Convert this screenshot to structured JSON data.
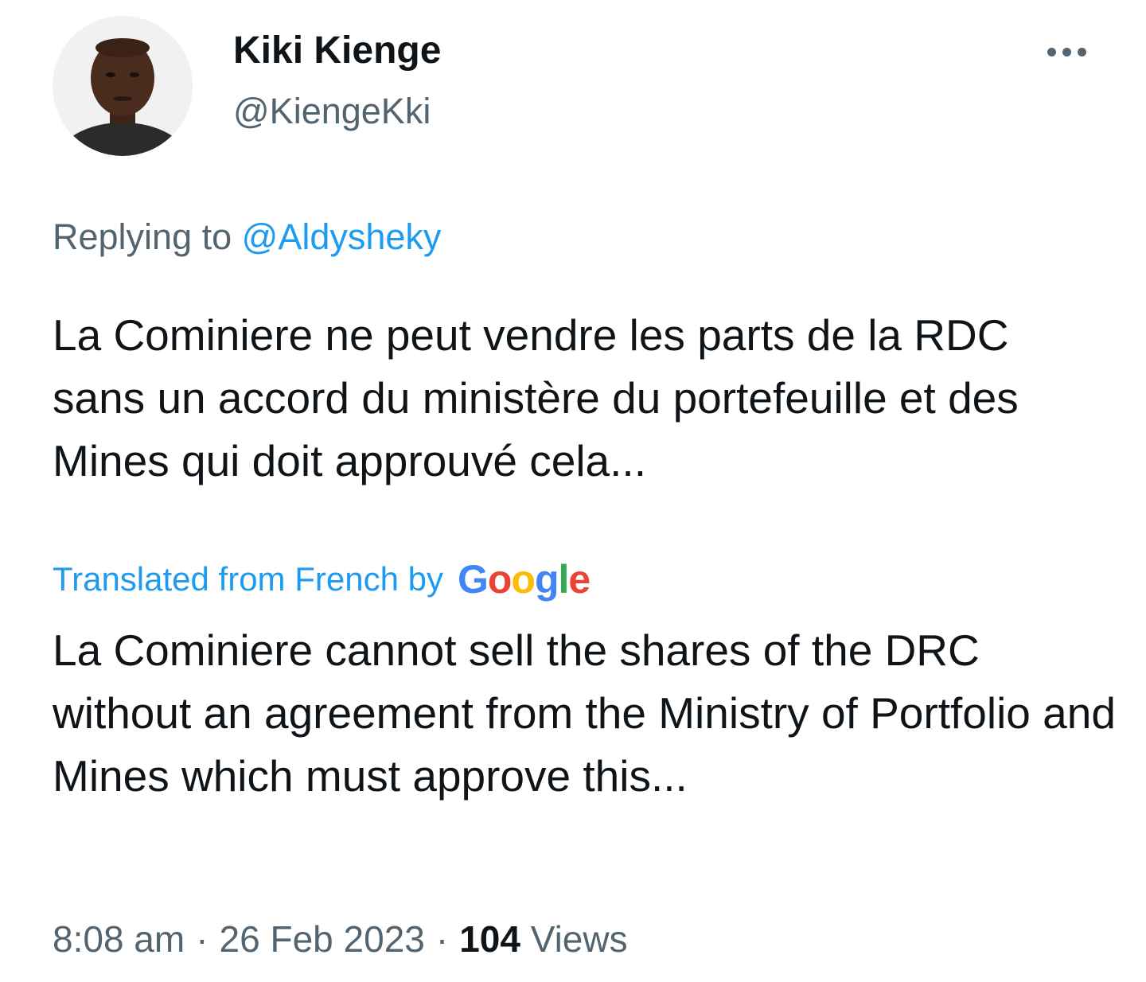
{
  "tweet": {
    "author": {
      "display_name": "Kiki Kienge",
      "handle": "@KiengeKki"
    },
    "more_icon": "more-horizontal-icon",
    "replying_to": {
      "prefix": "Replying to",
      "mention": "@Aldysheky"
    },
    "text": "La Cominiere ne peut vendre les parts de la RDC sans un accord du ministère du portefeuille et des Mines qui doit approuvé cela...",
    "translation": {
      "label": "Translated from French by",
      "provider": "Google",
      "text": "La Cominiere cannot sell the shares of the DRC without an agreement from the Ministry of Portfolio and Mines which must approve this..."
    },
    "meta": {
      "time": "8:08 am",
      "date": "26 Feb 2023",
      "separator": "·",
      "views_count": "104",
      "views_label": "Views"
    }
  },
  "colors": {
    "text_primary": "#0f1419",
    "text_secondary": "#536471",
    "link": "#1d9bf0",
    "google_blue": "#4285f4",
    "google_red": "#ea4335",
    "google_yellow": "#fbbc05",
    "google_green": "#34a853"
  }
}
